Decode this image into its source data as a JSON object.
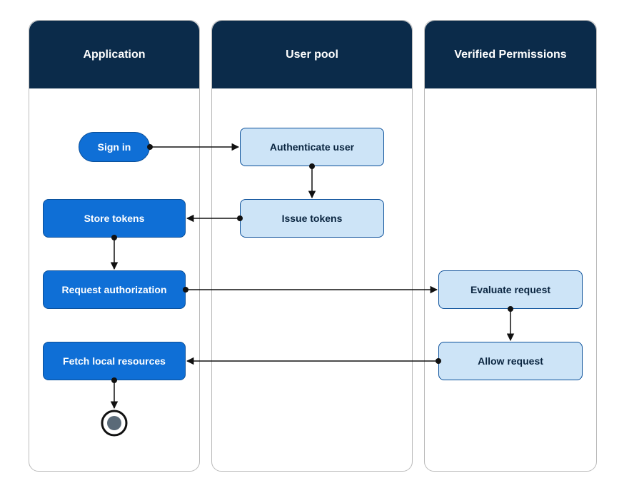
{
  "lanes": {
    "application": {
      "title": "Application"
    },
    "userpool": {
      "title": "User pool"
    },
    "verified": {
      "title": "Verified Permissions"
    }
  },
  "nodes": {
    "signIn": "Sign in",
    "auth": "Authenticate user",
    "issue": "Issue tokens",
    "store": "Store tokens",
    "request": "Request authorization",
    "evaluate": "Evaluate request",
    "allow": "Allow request",
    "fetch": "Fetch local resources"
  },
  "colors": {
    "header": "#0b2b4a",
    "darkNode": "#0f6fd6",
    "lightNode": "#cde4f7",
    "border": "#0a4f99"
  }
}
